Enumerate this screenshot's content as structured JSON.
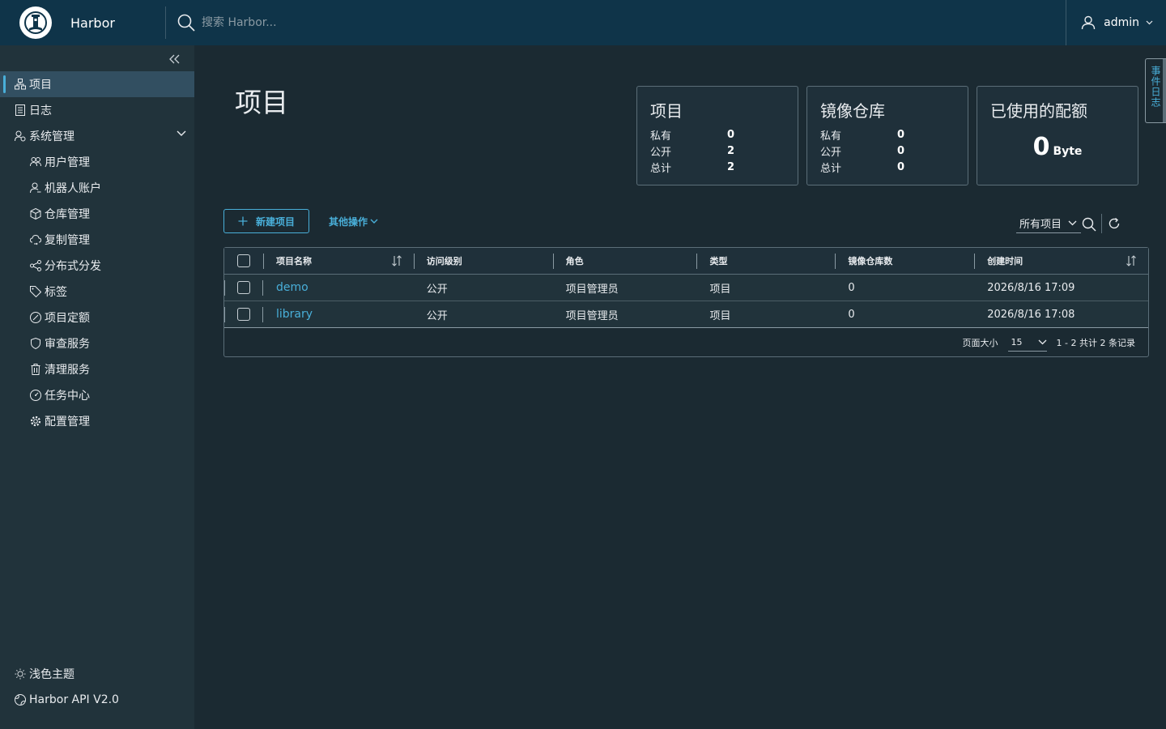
{
  "header": {
    "brand": "Harbor",
    "search_placeholder": "搜索 Harbor...",
    "user": "admin"
  },
  "sidebar": {
    "items": [
      {
        "label": "项目",
        "icon": "projects-icon",
        "active": true
      },
      {
        "label": "日志",
        "icon": "logs-icon"
      },
      {
        "label": "系统管理",
        "icon": "administration-icon"
      }
    ],
    "sub_items": [
      {
        "label": "用户管理",
        "icon": "users-icon"
      },
      {
        "label": "机器人账户",
        "icon": "robot-account-icon"
      },
      {
        "label": "仓库管理",
        "icon": "registries-icon"
      },
      {
        "label": "复制管理",
        "icon": "replication-icon"
      },
      {
        "label": "分布式分发",
        "icon": "distribution-icon"
      },
      {
        "label": "标签",
        "icon": "tag-icon"
      },
      {
        "label": "项目定额",
        "icon": "quota-icon"
      },
      {
        "label": "审查服务",
        "icon": "shield-icon"
      },
      {
        "label": "清理服务",
        "icon": "trash-icon"
      },
      {
        "label": "任务中心",
        "icon": "dashboard-icon"
      },
      {
        "label": "配置管理",
        "icon": "gear-icon"
      }
    ],
    "footer": [
      {
        "label": "浅色主题",
        "icon": "sun-icon"
      },
      {
        "label": "Harbor API V2.0",
        "icon": "api-icon"
      }
    ]
  },
  "main": {
    "title": "项目",
    "cards": {
      "projects": {
        "title": "项目",
        "private_label": "私有",
        "private": "0",
        "public_label": "公开",
        "public": "2",
        "total_label": "总计",
        "total": "2"
      },
      "repositories": {
        "title": "镜像仓库",
        "private_label": "私有",
        "private": "0",
        "public_label": "公开",
        "public": "0",
        "total_label": "总计",
        "total": "0"
      },
      "quota": {
        "title": "已使用的配额",
        "value": "0",
        "unit": "Byte"
      }
    },
    "new_project_label": "新建项目",
    "more_actions_label": "其他操作",
    "filter_label": "所有项目",
    "table": {
      "columns": [
        "项目名称",
        "访问级别",
        "角色",
        "类型",
        "镜像仓库数",
        "创建时间"
      ],
      "rows": [
        {
          "name": "demo",
          "access": "公开",
          "role": "项目管理员",
          "type": "项目",
          "repos": "0",
          "created": "2026/8/16 17:09"
        },
        {
          "name": "library",
          "access": "公开",
          "role": "项目管理员",
          "type": "项目",
          "repos": "0",
          "created": "2026/8/16 17:08"
        }
      ],
      "page_size_label": "页面大小",
      "page_size": "15",
      "page_info": "1 - 2 共计 2 条记录"
    },
    "event_log_label": "事件日志"
  },
  "colors": {
    "header_bg": "#0f3449",
    "sidebar_bg": "#21333b",
    "main_bg": "#1b2a32",
    "accent": "#49afd9"
  }
}
